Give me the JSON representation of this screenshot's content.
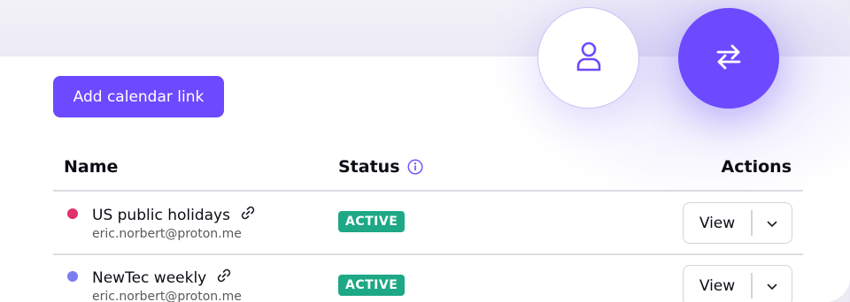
{
  "toolbar": {
    "add_calendar_link_label": "Add calendar link"
  },
  "table": {
    "headers": {
      "name": "Name",
      "status": "Status",
      "actions": "Actions"
    },
    "rows": [
      {
        "name": "US public holidays",
        "email": "eric.norbert@proton.me",
        "color": "#e0306e",
        "status": "ACTIVE",
        "view_label": "View"
      },
      {
        "name": "NewTec weekly",
        "email": "eric.norbert@proton.me",
        "color": "#7b7cf0",
        "status": "ACTIVE",
        "view_label": "View"
      }
    ]
  },
  "icons": {
    "user_circle": "user-icon",
    "switch_circle": "arrows-swap-icon",
    "status_info": "info-icon",
    "row_link": "link-icon",
    "view_menu": "chevron-down-icon"
  },
  "colors": {
    "accent": "#6d4aff",
    "status_active": "#1ea885"
  }
}
